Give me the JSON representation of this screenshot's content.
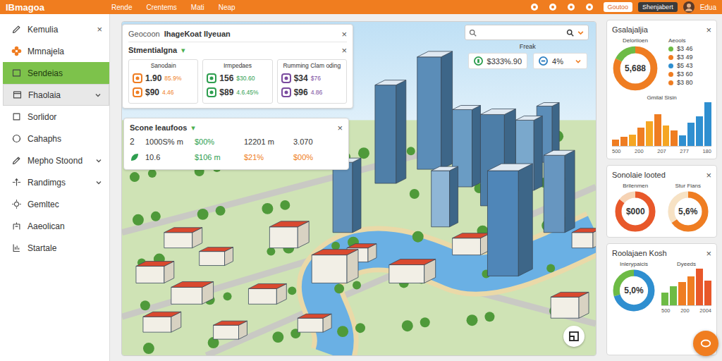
{
  "topbar": {
    "logo": "IBmagoa",
    "menu": [
      "Rende",
      "Crentems",
      "Mati",
      "Neap"
    ],
    "buttons": [
      {
        "label": "Goutoo",
        "selected": false
      },
      {
        "label": "Shenjabert",
        "selected": true
      }
    ],
    "user": "Edua"
  },
  "sidebar": {
    "items": [
      {
        "label": "Kemulia",
        "selected": false,
        "highlighted": false,
        "expandable": false,
        "close": "×"
      },
      {
        "label": "Mmnajela",
        "selected": false,
        "highlighted": false,
        "expandable": false
      },
      {
        "label": "Sendeias",
        "selected": true,
        "highlighted": false,
        "expandable": false
      },
      {
        "label": "Fhaolaia",
        "selected": false,
        "highlighted": true,
        "expandable": true
      },
      {
        "label": "Sorlidor",
        "selected": false,
        "highlighted": false,
        "expandable": false
      },
      {
        "label": "Cahaphs",
        "selected": false,
        "highlighted": false,
        "expandable": false
      },
      {
        "label": "Mepho Stoond",
        "selected": false,
        "highlighted": false,
        "expandable": true
      },
      {
        "label": "Randimgs",
        "selected": false,
        "highlighted": false,
        "expandable": true
      },
      {
        "label": "Gemltec",
        "selected": false,
        "highlighted": false,
        "expandable": false
      },
      {
        "label": "Aaeolican",
        "selected": false,
        "highlighted": false,
        "expandable": false
      },
      {
        "label": "Startale",
        "selected": false,
        "highlighted": false,
        "expandable": false
      }
    ]
  },
  "overview_panel": {
    "title": "Geocoon",
    "subtitle": "IhageKoat Ilyeuan",
    "close": "×",
    "section": {
      "title": "Stmentialgna",
      "caret": "▾",
      "close": "×"
    },
    "cards": [
      {
        "title": "Sanodain",
        "color": "#ef7d22",
        "rows": [
          {
            "value": "1.90",
            "detail": "85.9%"
          },
          {
            "value": "$90",
            "detail": "4.46"
          }
        ]
      },
      {
        "title": "Irmpedaes",
        "color": "#2e9e4f",
        "rows": [
          {
            "value": "156",
            "detail": "$30.60"
          },
          {
            "value": "$89",
            "detail": "4.6.45%"
          }
        ]
      },
      {
        "title": "Rumming Clam oding",
        "color": "#7a4a9e",
        "rows": [
          {
            "value": "$34",
            "detail": "$76"
          },
          {
            "value": "$96",
            "detail": "4.86"
          }
        ]
      }
    ]
  },
  "scores_panel": {
    "title": "Scone Ieaufoos",
    "caret": "▾",
    "close": "×",
    "rows": [
      {
        "kind": "number",
        "lead": "2",
        "cells": [
          {
            "text": "1000S% m",
            "color": "#333333"
          },
          {
            "text": "$00%",
            "color": "#2e9e4f"
          },
          {
            "text": "12201 m",
            "color": "#333333"
          },
          {
            "text": "3.070",
            "color": "#333333"
          }
        ]
      },
      {
        "kind": "icon",
        "cells": [
          {
            "text": "10.6",
            "color": "#333333"
          },
          {
            "text": "$106 m",
            "color": "#2e9e4f"
          },
          {
            "text": "$21%",
            "color": "#ef7d22"
          },
          {
            "text": "$00%",
            "color": "#ef7d22"
          }
        ]
      }
    ]
  },
  "metrics": {
    "label": "Freak",
    "chips": [
      {
        "value": "$333%.90",
        "color": "#2e9e4f"
      },
      {
        "value": "4%",
        "color": "#2f7fc1"
      }
    ]
  },
  "stats_card": {
    "title": "Gsalajaljia",
    "close": "×",
    "donut": {
      "label": "Deloriioen",
      "value": "5,688",
      "segments": [
        {
          "value": 82,
          "color": "#ef7d22"
        },
        {
          "value": 18,
          "color": "#6dbb45"
        }
      ]
    },
    "legend": {
      "title": "Aeools",
      "items": [
        {
          "label": "$3 46",
          "color": "#6dbb45"
        },
        {
          "label": "$3 49",
          "color": "#ef7d22"
        },
        {
          "label": "$5 43",
          "color": "#2f8fd0"
        },
        {
          "label": "$3 60",
          "color": "#ef7d22"
        },
        {
          "label": "$3 80",
          "color": "#ef7d22"
        }
      ]
    },
    "chart": {
      "title": "Gmilal Sisin",
      "ticks": [
        "500",
        "200",
        "207",
        "277",
        "180"
      ],
      "bars": [
        {
          "value": 12,
          "color": "#ef7d22"
        },
        {
          "value": 18,
          "color": "#ef7d22"
        },
        {
          "value": 22,
          "color": "#f5a623"
        },
        {
          "value": 35,
          "color": "#ef7d22"
        },
        {
          "value": 48,
          "color": "#f5a623"
        },
        {
          "value": 62,
          "color": "#ef7d22"
        },
        {
          "value": 40,
          "color": "#f5a623"
        },
        {
          "value": 30,
          "color": "#ef7d22"
        },
        {
          "value": 20,
          "color": "#2f8fd0"
        },
        {
          "value": 45,
          "color": "#2f8fd0"
        },
        {
          "value": 58,
          "color": "#2f8fd0"
        },
        {
          "value": 85,
          "color": "#2f8fd0"
        }
      ]
    }
  },
  "load_card": {
    "title": "Sonolaie looted",
    "close": "×",
    "donuts": [
      {
        "label": "Brilenmen",
        "value": "$000",
        "segments": [
          {
            "value": 85,
            "color": "#e8582a"
          },
          {
            "value": 15,
            "color": "#f6d3b4"
          }
        ]
      },
      {
        "label": "Stur Fians",
        "value": "5,6%",
        "segments": [
          {
            "value": 65,
            "color": "#ef7d22"
          },
          {
            "value": 35,
            "color": "#f7e2c4"
          }
        ]
      }
    ]
  },
  "region_card": {
    "title": "Roolajaen Kosh",
    "close": "×",
    "donut": {
      "label": "Inlerypaicis",
      "value": "5,0%",
      "segments": [
        {
          "value": 70,
          "color": "#2f8fd0"
        },
        {
          "value": 30,
          "color": "#6dbb45"
        }
      ]
    },
    "chart": {
      "title": "Dyeeds",
      "ticks": [
        "500",
        "200",
        "2004"
      ],
      "bars": [
        {
          "value": 30,
          "color": "#6dbb45"
        },
        {
          "value": 45,
          "color": "#6dbb45"
        },
        {
          "value": 55,
          "color": "#ef7d22"
        },
        {
          "value": 70,
          "color": "#ef7d22"
        },
        {
          "value": 88,
          "color": "#e8582a"
        },
        {
          "value": 60,
          "color": "#e8582a"
        }
      ]
    }
  }
}
